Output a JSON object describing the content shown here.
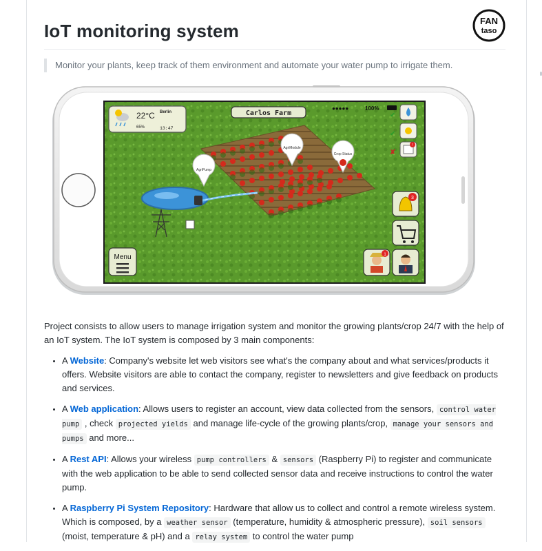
{
  "page": {
    "title": "IoT monitoring system",
    "logo_text_top": "FAN",
    "logo_text_bottom": "taso",
    "subtitle": "Monitor your plants, keep track of them environment and automate your water pump to irrigate them."
  },
  "app": {
    "farm_name": "Carlos Farm",
    "weather": {
      "temp": "22°C",
      "humidity": "65%",
      "city": "Berlin",
      "time": "13:47"
    },
    "status": {
      "battery": "100%"
    },
    "menu_label": "Menu",
    "bell_badge": "3",
    "calendar_badge": "!",
    "farmer_badge": "1",
    "markers": [
      "AgriPump",
      "AgriModule",
      "Crop Status"
    ]
  },
  "intro": "Project consists to allow users to manage irrigation system and monitor the growing plants/crop 24/7 with the help of an IoT system. The IoT system is composed by 3 main components:",
  "items": [
    {
      "prefix": "A ",
      "link": "Website",
      "text": ": Company's website let web visitors see what's the company about and what services/products it offers. Website visitors are able to contact the company, register to newsletters and give feedback on products and services."
    },
    {
      "prefix": "A ",
      "link": "Web application",
      "t1": ": Allows users to register an account, view data collected from the sensors, ",
      "c1": "control water pump",
      "t2": " , check ",
      "c2": "projected yields",
      "t3": " and manage life-cycle of the growing plants/crop, ",
      "c3": "manage your sensors and pumps",
      "t4": " and more..."
    },
    {
      "prefix": "A ",
      "link": "Rest API",
      "t1": ": Allows your wireless ",
      "c1": "pump controllers",
      "t2": " & ",
      "c2": "sensors",
      "t3": " (Raspberry Pi) to register and communicate with the web application to be able to send collected sensor data and receive instructions to control the water pump."
    },
    {
      "prefix": "A ",
      "link": "Raspberry Pi System Repository",
      "t1": ": Hardware that allow us to collect and control a remote wireless system. Which is composed, by a ",
      "c1": "weather sensor",
      "t2": " (temperature, humidity & atmospheric pressure), ",
      "c2": "soil sensors",
      "t3": " (moist, temperature & pH) and a ",
      "c3": "relay system",
      "t4": " to control the water pump"
    }
  ]
}
